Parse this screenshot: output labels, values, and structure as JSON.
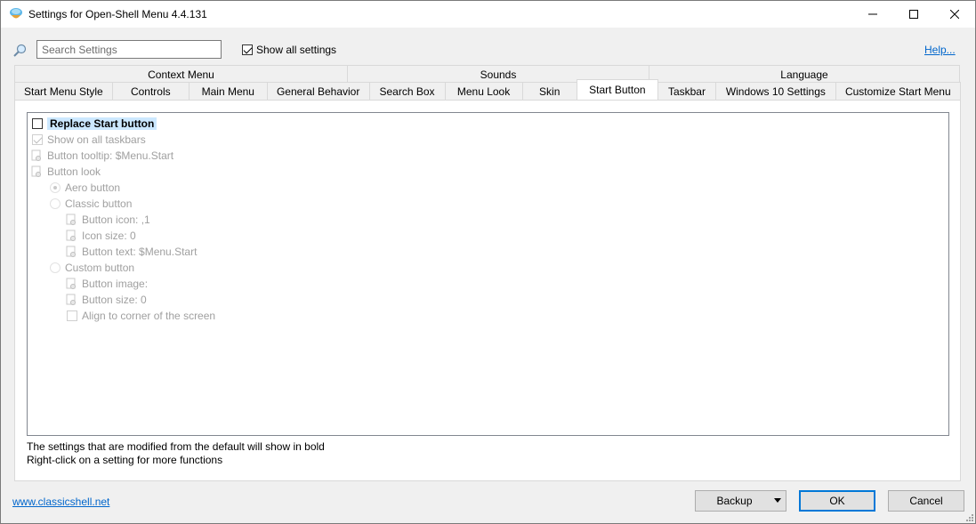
{
  "window": {
    "title": "Settings for Open-Shell Menu 4.4.131",
    "minimize_glyph": "—",
    "maximize_glyph": "☐",
    "close_glyph": "✕"
  },
  "search": {
    "placeholder": "Search Settings",
    "value": ""
  },
  "show_all": {
    "label": "Show all settings",
    "checked": true
  },
  "help_link": "Help...",
  "tabs_row1": [
    {
      "label": "Context Menu"
    },
    {
      "label": "Sounds"
    },
    {
      "label": "Language"
    }
  ],
  "tabs_row2": [
    {
      "label": "Start Menu Style"
    },
    {
      "label": "Controls"
    },
    {
      "label": "Main Menu"
    },
    {
      "label": "General Behavior"
    },
    {
      "label": "Search Box"
    },
    {
      "label": "Menu Look"
    },
    {
      "label": "Skin"
    },
    {
      "label": "Start Button",
      "active": true
    },
    {
      "label": "Taskbar"
    },
    {
      "label": "Windows 10 Settings"
    },
    {
      "label": "Customize Start Menu"
    }
  ],
  "settings": [
    {
      "label": "Replace Start button",
      "control": "checkbox",
      "checked": false,
      "enabled": true,
      "selected": true
    },
    {
      "label": "Show on all taskbars",
      "control": "checkbox",
      "checked": true,
      "enabled": false
    },
    {
      "label": "Button tooltip: $Menu.Start",
      "control": "icon",
      "enabled": false
    },
    {
      "label": "Button look",
      "control": "icon",
      "enabled": false
    },
    {
      "label": "Aero button",
      "control": "radio",
      "checked": true,
      "enabled": false
    },
    {
      "label": "Classic button",
      "control": "radio",
      "checked": false,
      "enabled": false
    },
    {
      "label": "Button icon: ,1",
      "control": "icon",
      "enabled": false
    },
    {
      "label": "Icon size: 0",
      "control": "icon",
      "enabled": false
    },
    {
      "label": "Button text: $Menu.Start",
      "control": "icon",
      "enabled": false
    },
    {
      "label": "Custom button",
      "control": "radio",
      "checked": false,
      "enabled": false
    },
    {
      "label": "Button image:",
      "control": "icon",
      "enabled": false
    },
    {
      "label": "Button size: 0",
      "control": "icon",
      "enabled": false
    },
    {
      "label": "Align to corner of the screen",
      "control": "checkbox",
      "checked": false,
      "enabled": false
    }
  ],
  "info": {
    "line1": "The settings that are modified from the default will show in bold",
    "line2": "Right-click on a setting for more functions"
  },
  "footer": {
    "site_link": "www.classicshell.net",
    "backup_label": "Backup",
    "ok_label": "OK",
    "cancel_label": "Cancel"
  },
  "colors": {
    "accent": "#0078d7",
    "link": "#0066cc",
    "selection": "#cce8ff",
    "disabled_text": "#a0a0a0"
  }
}
